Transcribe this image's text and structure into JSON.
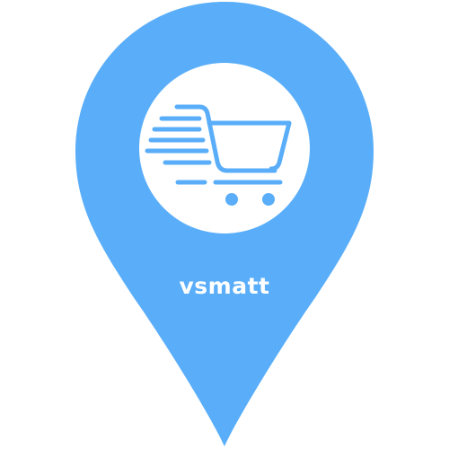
{
  "logo": {
    "brand_name": "vsmatt",
    "icon": "shopping-cart-icon",
    "shape": "map-pin",
    "colors": {
      "pin": "#5aaef9",
      "circle": "#ffffff",
      "text": "#ffffff"
    }
  }
}
